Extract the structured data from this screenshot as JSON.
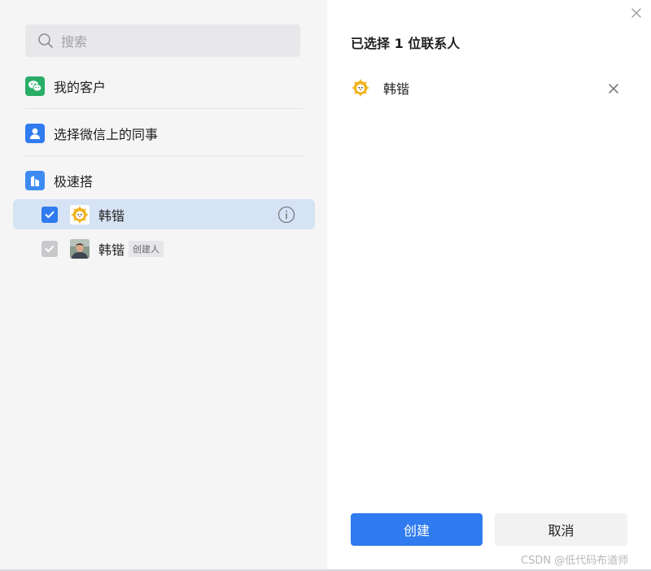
{
  "search": {
    "placeholder": "搜索"
  },
  "sections": {
    "customers": {
      "label": "我的客户"
    },
    "colleagues": {
      "label": "选择微信上的同事"
    },
    "org": {
      "label": "极速搭"
    }
  },
  "members": [
    {
      "name": "韩锴",
      "checked": true,
      "disabled": false,
      "tag": ""
    },
    {
      "name": "韩锴",
      "checked": true,
      "disabled": true,
      "tag": "创建人"
    }
  ],
  "right": {
    "title": "已选择 1 位联系人",
    "selected": [
      {
        "name": "韩锴"
      }
    ]
  },
  "buttons": {
    "create": "创建",
    "cancel": "取消"
  },
  "watermark": "CSDN @低代码布道师",
  "colors": {
    "accent": "#2f7bef",
    "wechat": "#2aae67",
    "contact": "#2f7bef",
    "org": "#3d8bf0"
  },
  "icons": {
    "search": "search-icon",
    "customers": "wechat-icon",
    "colleagues": "person-icon",
    "org": "building-icon",
    "close": "close-icon",
    "info": "info-icon"
  }
}
